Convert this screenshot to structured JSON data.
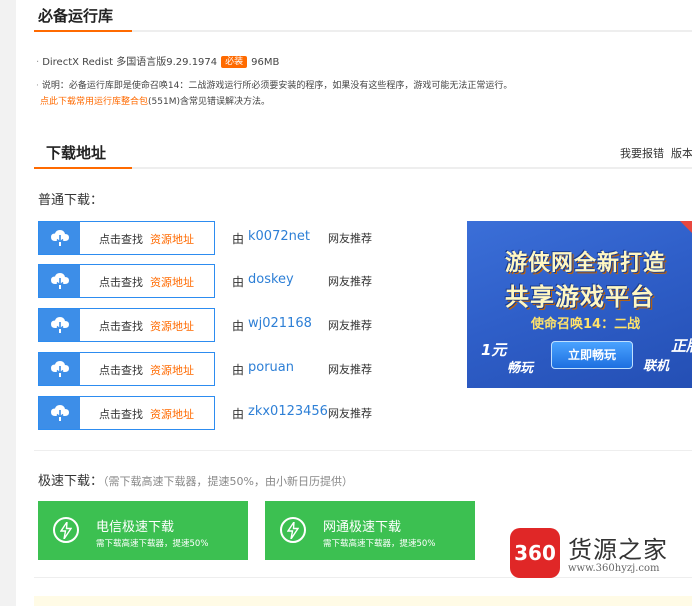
{
  "runtime": {
    "title": "必备运行库",
    "item": {
      "name": "DirectX Redist 多国语言版9.29.1974",
      "badge": "必装",
      "size": "96MB"
    },
    "note": "说明：必备运行库即是使命召唤14：二战游戏运行所必须要安装的程序，如果没有这些程序，游戏可能无法正常运行。",
    "pack_link": "点此下载常用运行库整合包",
    "pack_tail": "(551M)含常见错误解决方法。"
  },
  "download": {
    "title": "下载地址",
    "report": "我要报错",
    "version": "版本",
    "normal_label": "普通下载：",
    "btn_text": "点击查找",
    "btn_link": "资源地址",
    "by": "由",
    "recommend": "网友推荐",
    "rows": [
      {
        "user": "k0072net"
      },
      {
        "user": "doskey"
      },
      {
        "user": "wj021168"
      },
      {
        "user": "poruan"
      },
      {
        "user": "zkx0123456"
      }
    ]
  },
  "ad": {
    "line1": "游侠网全新打造",
    "line2": "共享游戏平台",
    "game": "使命召唤14：二战",
    "play": "立即畅玩",
    "left_a": "1元",
    "left_b": "畅玩",
    "right_a": "正版",
    "right_b": "联机"
  },
  "fast": {
    "label": "极速下载：",
    "desc": "（需下载高速下载器，提速50%，由小新日历提供）",
    "buttons": [
      {
        "title": "电信极速下载",
        "sub": "需下载高速下载器，提速50%"
      },
      {
        "title": "网通极速下载",
        "sub": "需下载高速下载器，提速50%"
      }
    ]
  },
  "watermark": {
    "logo": "360",
    "name": "货源之家",
    "url": "www.360hyzj.com"
  },
  "colors": {
    "accent": "#ff6a00",
    "blue": "#2d8cf0",
    "green": "#3cc051"
  }
}
